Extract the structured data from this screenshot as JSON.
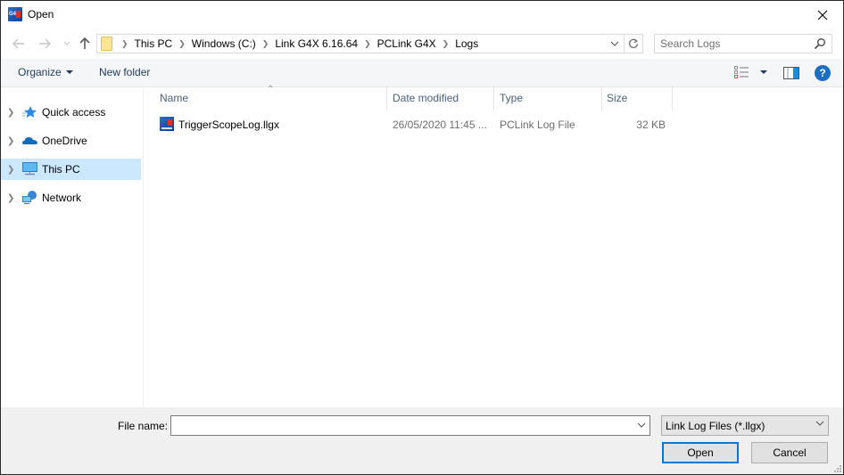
{
  "window": {
    "title": "Open",
    "app_icon": "g4x-app-icon",
    "app_icon_text": "G4X"
  },
  "navigation": {
    "back_icon": "arrow-left-icon",
    "forward_icon": "arrow-right-icon",
    "recent_icon": "chevron-down-icon",
    "up_icon": "arrow-up-icon",
    "breadcrumbs": [
      "This PC",
      "Windows (C:)",
      "Link G4X 6.16.64",
      "PCLink G4X",
      "Logs"
    ],
    "search_placeholder": "Search Logs"
  },
  "commandbar": {
    "organize_label": "Organize",
    "new_folder_label": "New folder",
    "help_label": "?"
  },
  "navpane": {
    "items": [
      {
        "label": "Quick access",
        "icon": "star-icon",
        "selected": false
      },
      {
        "label": "OneDrive",
        "icon": "cloud-icon",
        "selected": false
      },
      {
        "label": "This PC",
        "icon": "computer-icon",
        "selected": true
      },
      {
        "label": "Network",
        "icon": "network-icon",
        "selected": false
      }
    ]
  },
  "filelist": {
    "columns": [
      "Name",
      "Date modified",
      "Type",
      "Size"
    ],
    "sort_column": "Name",
    "sort_direction": "ascending",
    "rows": [
      {
        "name": "TriggerScopeLog.llgx",
        "date": "26/05/2020 11:45 ...",
        "type": "PCLink Log File",
        "size": "32 KB"
      }
    ]
  },
  "footer": {
    "file_name_label": "File name:",
    "file_name_value": "",
    "filter_value": "Link Log Files (*.llgx)",
    "open_label": "Open",
    "cancel_label": "Cancel"
  },
  "colors": {
    "selection": "#cce8ff",
    "accent": "#0078d7",
    "command_text": "#1e395b",
    "header_text": "#4c607a",
    "help_blue": "#1d6ec5"
  }
}
